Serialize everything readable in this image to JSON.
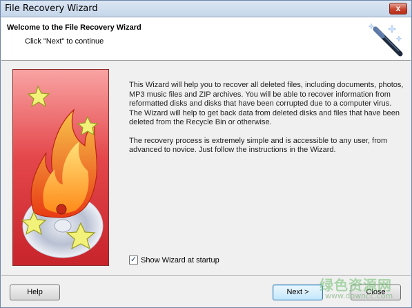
{
  "window": {
    "title": "File Recovery Wizard",
    "close_glyph": "x"
  },
  "header": {
    "title": "Welcome to the File Recovery Wizard",
    "subtitle": "Click \"Next\" to continue",
    "icon": "magic-wand-icon"
  },
  "side_image": {
    "icon": "fire-disc-stars-illustration"
  },
  "body": {
    "paragraph1": "This Wizard will help you to recover all deleted files, including documents, photos, MP3 music files and ZIP archives. You will be able to recover information from reformatted disks and disks that have been corrupted due to a computer virus. The Wizard will help to get back data from deleted disks and files that have been deleted from the Recycle Bin or otherwise.",
    "paragraph2": "The recovery process is extremely simple and is accessible to any user, from advanced to novice. Just follow the instructions in the Wizard."
  },
  "startup_checkbox": {
    "label": "Show Wizard at startup",
    "checked": true,
    "check_glyph": "✓"
  },
  "buttons": {
    "help": "Help",
    "next": "Next >",
    "close": "Close"
  },
  "watermark": {
    "text": "绿色资源网",
    "url": "www.downcc.com"
  },
  "colors": {
    "panel_background": "#f0f0f0",
    "header_background": "#ffffff",
    "image_red": "#d9363a"
  }
}
